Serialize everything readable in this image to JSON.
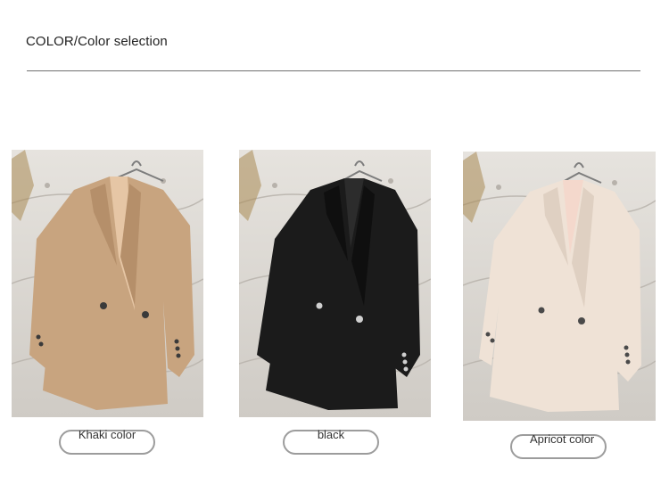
{
  "header": {
    "title": "COLOR/Color selection"
  },
  "colors": {
    "background": "#ffffff",
    "rule": "#6f6f6f",
    "pill_border": "#9c9c9c",
    "khaki": "#c8a47f",
    "black": "#1b1b1b",
    "apricot": "#efe2d6"
  },
  "options": [
    {
      "label": "Khaki color",
      "image": "khaki-blazer-photo"
    },
    {
      "label": "black",
      "image": "black-blazer-photo"
    },
    {
      "label": "Apricot color",
      "image": "apricot-blazer-photo"
    }
  ]
}
